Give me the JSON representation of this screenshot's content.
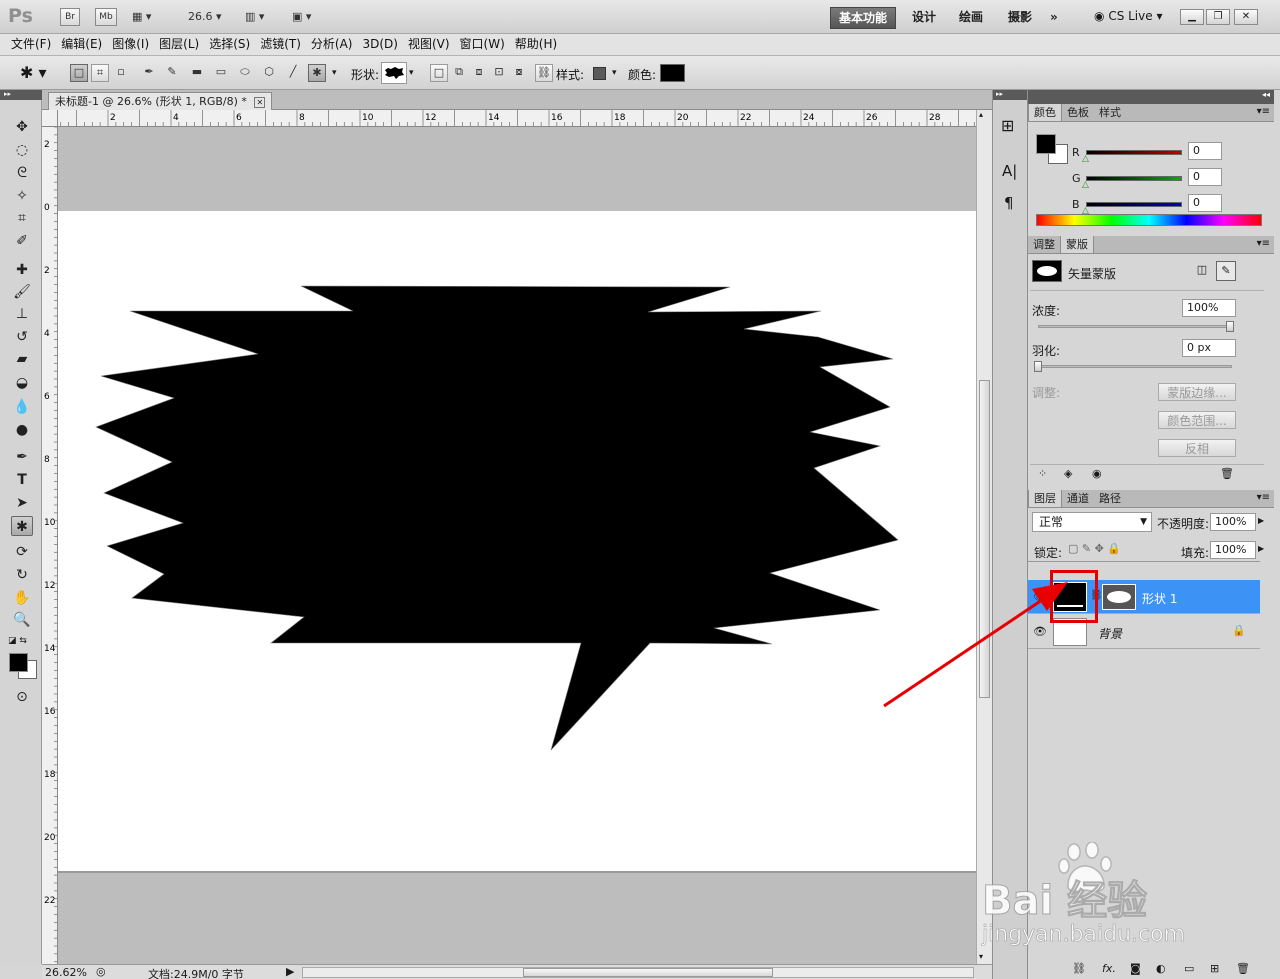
{
  "app": {
    "logo": "Ps",
    "bridge": "Br",
    "minibridge": "Mb",
    "zoom_dropdown": "26.6",
    "workspaces": [
      "基本功能",
      "设计",
      "绘画",
      "摄影"
    ],
    "more_workspaces": "»",
    "cslive": "CS Live"
  },
  "menu": [
    "文件(F)",
    "编辑(E)",
    "图像(I)",
    "图层(L)",
    "选择(S)",
    "滤镜(T)",
    "分析(A)",
    "3D(D)",
    "视图(V)",
    "窗口(W)",
    "帮助(H)"
  ],
  "options": {
    "shape_label": "形状:",
    "style_label": "样式:",
    "color_label": "颜色:",
    "color_value": "#000000"
  },
  "document": {
    "tab_title": "未标题-1 @ 26.6% (形状 1, RGB/8) *",
    "h_ruler_labels": [
      "2",
      "4",
      "6",
      "8",
      "10",
      "12",
      "14",
      "16",
      "18",
      "20",
      "22",
      "24",
      "26",
      "28"
    ],
    "v_ruler_labels": [
      "2",
      "0",
      "2",
      "4",
      "6",
      "8",
      "10",
      "12",
      "14",
      "16",
      "18",
      "20",
      "22"
    ]
  },
  "status": {
    "zoom": "26.62%",
    "doc_info": "文档:24.9M/0 字节"
  },
  "color_panel": {
    "tabs": [
      "颜色",
      "色板",
      "样式"
    ],
    "channels": [
      {
        "label": "R",
        "value": "0",
        "color": "#c00000"
      },
      {
        "label": "G",
        "value": "0",
        "color": "#00b000"
      },
      {
        "label": "B",
        "value": "0",
        "color": "#0000c0"
      }
    ]
  },
  "masks_panel": {
    "tabs": [
      "调整",
      "蒙版"
    ],
    "mask_type": "矢量蒙版",
    "density_label": "浓度:",
    "density_value": "100%",
    "feather_label": "羽化:",
    "feather_value": "0 px",
    "refine_label": "调整:",
    "btn_mask_edge": "蒙版边缘...",
    "btn_color_range": "颜色范围...",
    "btn_invert": "反相"
  },
  "layers_panel": {
    "tabs": [
      "图层",
      "通道",
      "路径"
    ],
    "blend_mode": "正常",
    "opacity_label": "不透明度:",
    "opacity_value": "100%",
    "lock_label": "锁定:",
    "fill_label": "填充:",
    "fill_value": "100%",
    "layers": [
      {
        "name": "形状 1",
        "selected": true
      },
      {
        "name": "背景",
        "selected": false
      }
    ]
  },
  "watermark": {
    "brand": "Bai 经验",
    "url": "jingyan.baidu.com"
  }
}
